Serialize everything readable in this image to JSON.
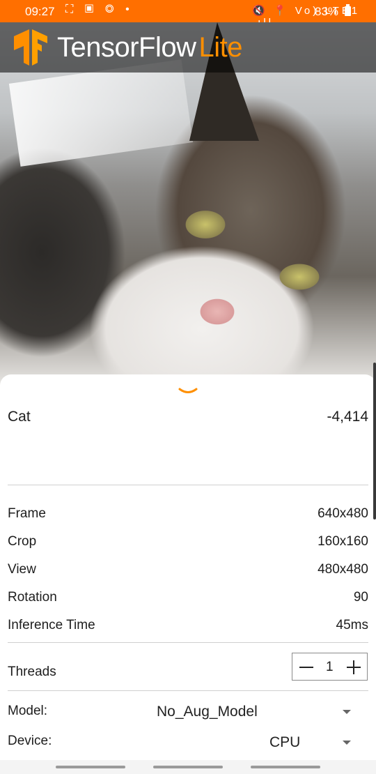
{
  "status_bar": {
    "time": "09:27",
    "left_icons": "⛶ ▣ ◎ •",
    "right_icons": "🔇 📍 Vo) LTE1 .ıll",
    "battery": "83%"
  },
  "toolbar": {
    "brand_main": "TensorFlow",
    "brand_accent": "Lite",
    "accent_color": "#ff8f00",
    "bar_color": "#ff6f00"
  },
  "result": {
    "label": "Cat",
    "score": "-4,414"
  },
  "info": [
    {
      "label": "Frame",
      "value": "640x480"
    },
    {
      "label": "Crop",
      "value": "160x160"
    },
    {
      "label": "View",
      "value": "480x480"
    },
    {
      "label": "Rotation",
      "value": "90"
    },
    {
      "label": "Inference Time",
      "value": "45ms"
    }
  ],
  "threads": {
    "label": "Threads",
    "value": "1"
  },
  "model": {
    "label": "Model:",
    "value": "No_Aug_Model"
  },
  "device": {
    "label": "Device:",
    "value": "CPU"
  }
}
